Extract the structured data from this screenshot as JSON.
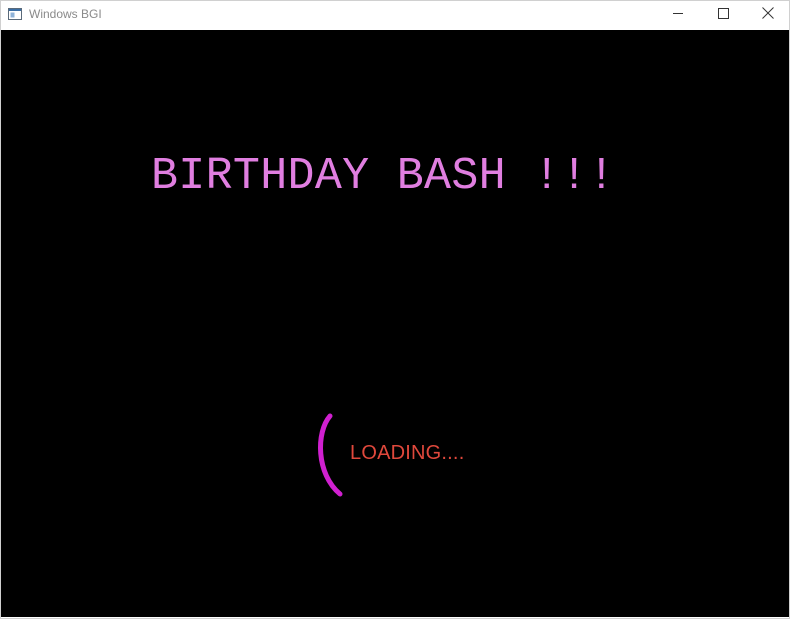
{
  "window": {
    "title": "Windows BGI",
    "app_icon": "bgi-window-icon",
    "controls": {
      "minimize_icon": "minimize-icon",
      "maximize_icon": "maximize-icon",
      "close_icon": "close-icon"
    }
  },
  "canvas": {
    "background_color": "#000000",
    "headline": "BIRTHDAY BASH !!!",
    "headline_color": "#e07ee0",
    "loading_text": "LOADING....",
    "loading_color": "#e0483c",
    "spinner_icon": "loading-spinner-arc-icon",
    "spinner_color": "#d020d0"
  }
}
